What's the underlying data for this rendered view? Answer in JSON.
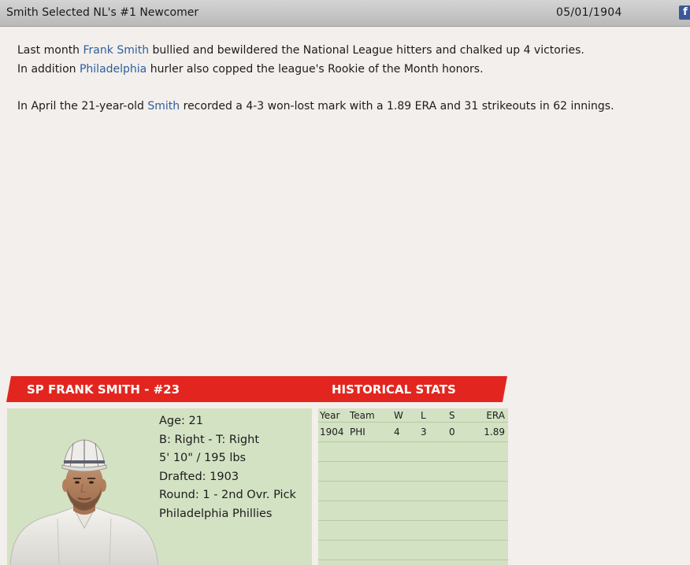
{
  "header": {
    "title": "Smith Selected NL's #1 Newcomer",
    "date": "05/01/1904",
    "share_icon_label": "f"
  },
  "article": {
    "p1_pre": "Last month ",
    "p1_link": "Frank Smith",
    "p1_post": " bullied and bewildered the National League hitters and chalked up 4 victories.",
    "p2_pre": "In addition ",
    "p2_link": "Philadelphia",
    "p2_post": " hurler also copped the league's Rookie of the Month honors.",
    "p3_pre": "In April the 21-year-old ",
    "p3_link": "Smith",
    "p3_post": " recorded a 4-3 won-lost mark with a 1.89 ERA and 31 strikeouts in 62 innings."
  },
  "card": {
    "header_name": "SP FRANK SMITH - #23",
    "header_stats": "HISTORICAL STATS",
    "bio": {
      "age": "Age: 21",
      "bats_throws": "B: Right - T: Right",
      "size": "5' 10\" / 195 lbs",
      "drafted": "Drafted: 1903",
      "round": "Round: 1 - 2nd Ovr. Pick",
      "team": "Philadelphia Phillies"
    },
    "stats": {
      "columns": [
        "Year",
        "Team",
        "W",
        "L",
        "S",
        "ERA"
      ],
      "rows": [
        [
          "1904",
          "PHI",
          "4",
          "3",
          "0",
          "1.89"
        ]
      ],
      "empty_row_count": 6
    }
  },
  "colors": {
    "header_red": "#e2261f",
    "panel_green": "#d3e2c3",
    "link_blue": "#2f5e9c",
    "background": "#f2efec"
  }
}
